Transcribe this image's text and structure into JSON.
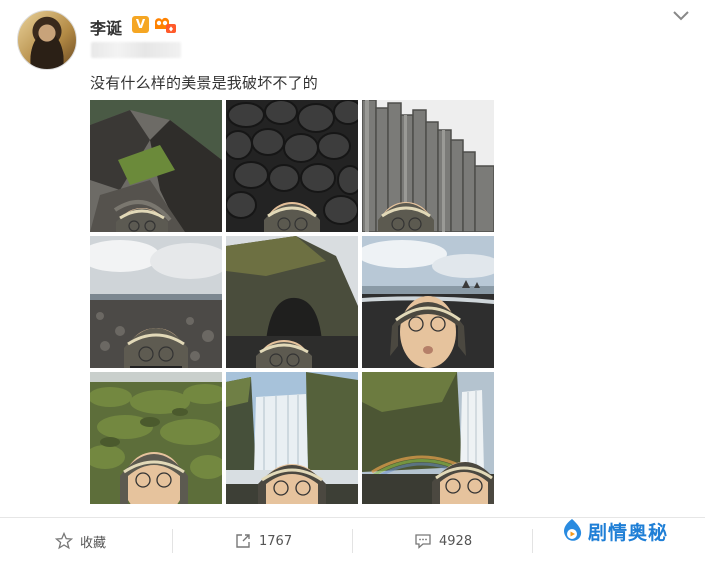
{
  "user": {
    "name": "李诞",
    "verified_badge": "V"
  },
  "post": {
    "text": "没有什么样的美景是我破坏不了的"
  },
  "photos": [
    {
      "label": "cliff-grass"
    },
    {
      "label": "basalt-rocks"
    },
    {
      "label": "basalt-columns"
    },
    {
      "label": "black-beach-cloudy"
    },
    {
      "label": "sea-arch"
    },
    {
      "label": "beach-sea-stacks"
    },
    {
      "label": "mossy-lava-field"
    },
    {
      "label": "waterfall-1"
    },
    {
      "label": "waterfall-rainbow"
    }
  ],
  "actions": {
    "favorite": {
      "label": "收藏",
      "icon": "star-icon"
    },
    "repost": {
      "count": "1767",
      "icon": "share-icon"
    },
    "comment": {
      "count": "4928",
      "icon": "comment-icon"
    }
  },
  "watermark": {
    "text": "剧情奥秘"
  },
  "colors": {
    "accent": "#1f7fd6",
    "badge": "#f5a623",
    "vip": "#ff8200"
  }
}
